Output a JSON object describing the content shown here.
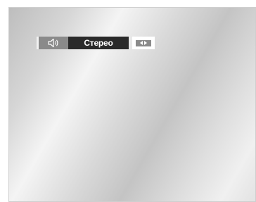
{
  "osd": {
    "audio_mode_label": "Стерео",
    "icons": {
      "speaker": "speaker-icon",
      "adjust": "left-right-arrows-icon"
    }
  },
  "colors": {
    "speaker_cell": "#8a8a8a",
    "mode_cell": "#2a2a2a",
    "mode_text": "#ffffff",
    "arrows_cell": "#ffffff",
    "arrows_box": "#8a8a8a"
  }
}
